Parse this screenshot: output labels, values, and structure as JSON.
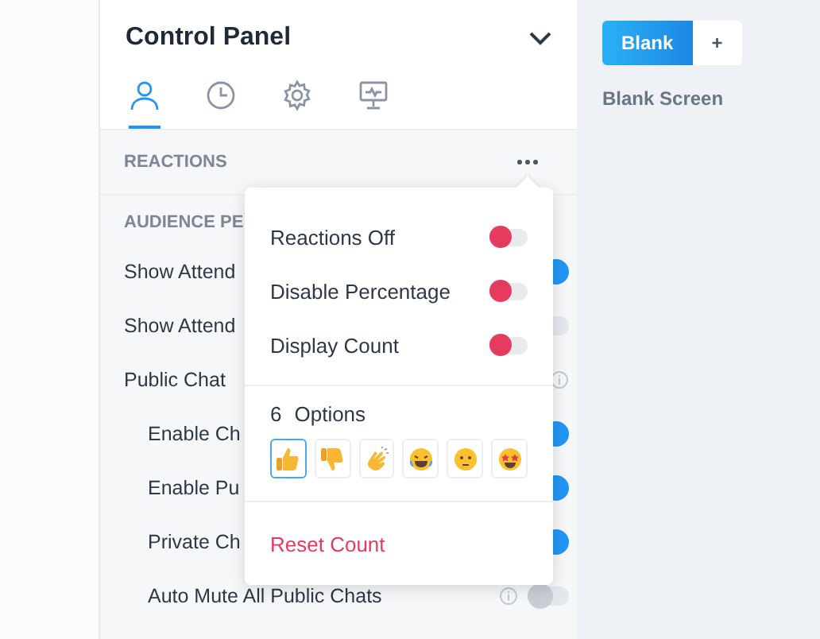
{
  "panel": {
    "title": "Control Panel",
    "tabs": [
      {
        "kind": "user",
        "selected": true
      },
      {
        "kind": "clock",
        "selected": false
      },
      {
        "kind": "gear",
        "selected": false
      },
      {
        "kind": "monitor",
        "selected": false
      }
    ],
    "section": "REACTIONS",
    "subsection": "AUDIENCE PE",
    "settings": [
      {
        "label": "Show Attend",
        "on": true
      },
      {
        "label": "Show Attend",
        "on": false
      },
      {
        "label": "Public Chat",
        "info": true,
        "children": [
          {
            "label": "Enable Ch",
            "on": true
          },
          {
            "label": "Enable Pu",
            "on": true
          },
          {
            "label": "Private Ch",
            "on": true
          },
          {
            "label": "Auto Mute All Public Chats",
            "on": false,
            "info": true
          }
        ]
      }
    ]
  },
  "popup": {
    "toggles": [
      {
        "label": "Reactions Off",
        "on": false
      },
      {
        "label": "Disable Percentage",
        "on": false
      },
      {
        "label": "Display Count",
        "on": false
      }
    ],
    "count": "6",
    "options_label": "Options",
    "emojis": [
      {
        "kind": "thumbs-up",
        "selected": true
      },
      {
        "kind": "thumbs-down",
        "selected": false
      },
      {
        "kind": "clap",
        "selected": false
      },
      {
        "kind": "laugh",
        "selected": false
      },
      {
        "kind": "neutral",
        "selected": false
      },
      {
        "kind": "star-eyes",
        "selected": false
      }
    ],
    "reset": "Reset Count"
  },
  "stage": {
    "buttons": [
      {
        "label": "Blank",
        "selected": true
      },
      {
        "label": "+",
        "selected": false
      }
    ],
    "title": "Blank Screen"
  }
}
